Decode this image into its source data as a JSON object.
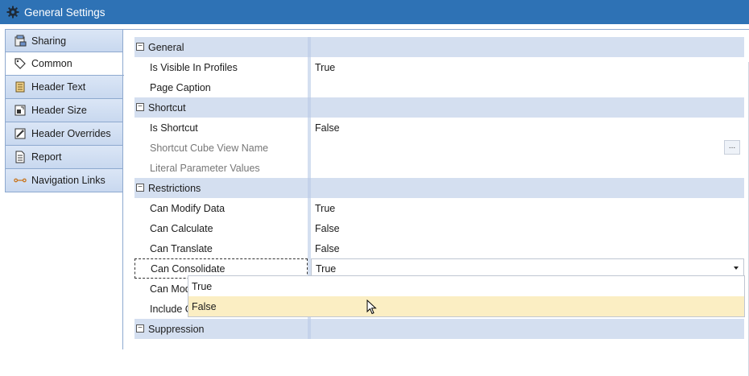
{
  "window": {
    "title": "General Settings",
    "icon": "gear-icon"
  },
  "tabs": [
    {
      "label": "Sharing",
      "icon": "sharing-icon",
      "active": false
    },
    {
      "label": "Common",
      "icon": "tag-icon",
      "active": true
    },
    {
      "label": "Header Text",
      "icon": "text-icon",
      "active": false
    },
    {
      "label": "Header Size",
      "icon": "resize-icon",
      "active": false
    },
    {
      "label": "Header Overrides",
      "icon": "override-icon",
      "active": false
    },
    {
      "label": "Report",
      "icon": "report-icon",
      "active": false
    },
    {
      "label": "Navigation Links",
      "icon": "link-icon",
      "active": false
    }
  ],
  "categories": {
    "general": {
      "label": "General",
      "expander": "⊟"
    },
    "shortcut": {
      "label": "Shortcut",
      "expander": "⊟"
    },
    "restrictions": {
      "label": "Restrictions",
      "expander": "⊟"
    },
    "suppression": {
      "label": "Suppression",
      "expander": "⊟"
    }
  },
  "properties": {
    "is_visible_in_profiles": {
      "name": "Is Visible In Profiles",
      "value": "True"
    },
    "page_caption": {
      "name": "Page Caption",
      "value": ""
    },
    "is_shortcut": {
      "name": "Is Shortcut",
      "value": "False"
    },
    "shortcut_cube_view_name": {
      "name": "Shortcut Cube View Name",
      "value": "",
      "button": "..."
    },
    "literal_parameter_values": {
      "name": "Literal Parameter Values",
      "value": ""
    },
    "can_modify_data": {
      "name": "Can Modify Data",
      "value": "True"
    },
    "can_calculate": {
      "name": "Can Calculate",
      "value": "False"
    },
    "can_translate": {
      "name": "Can Translate",
      "value": "False"
    },
    "can_consolidate": {
      "name": "Can Consolidate",
      "value": "True"
    },
    "can_modify_suppression": {
      "name": "Can Modify Suppression",
      "value": ""
    },
    "include_cell_attachment_status": {
      "name": "Include Cell Attachment Status",
      "value": ""
    }
  },
  "dropdown": {
    "options": [
      "True",
      "False"
    ],
    "hovered": "False"
  },
  "colors": {
    "titlebar": "#2e72b5",
    "category_bg": "#d4dff0",
    "hover": "#fbeec3"
  }
}
